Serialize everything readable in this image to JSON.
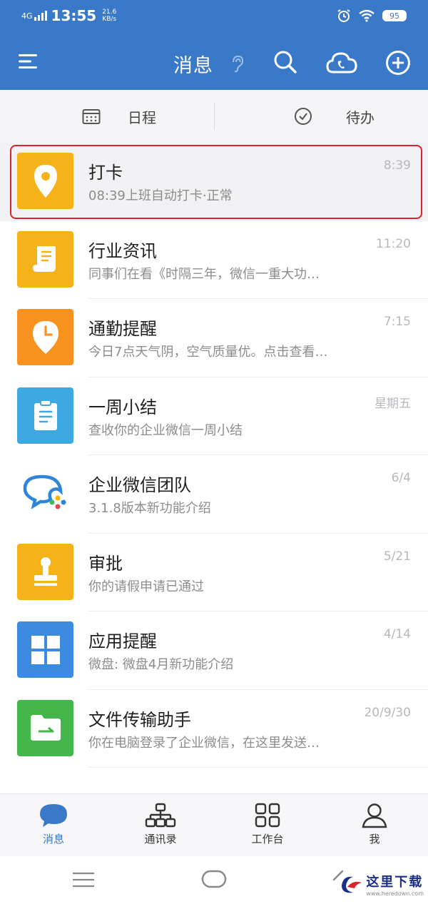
{
  "status_bar": {
    "network": "4G",
    "time": "13:55",
    "speed_value": "21.6",
    "speed_unit": "KB/s",
    "battery": "95"
  },
  "header": {
    "title": "消息"
  },
  "tabs": [
    {
      "label": "日程",
      "icon": "calendar-icon"
    },
    {
      "label": "待办",
      "icon": "check-circle-icon"
    }
  ],
  "messages": [
    {
      "name": "打卡",
      "preview": "08:39上班自动打卡·正常",
      "time": "8:39",
      "icon": "location-pin-icon",
      "color": "#f5b219"
    },
    {
      "name": "行业资讯",
      "preview": "同事们在看《时隔三年，微信一重大功…",
      "time": "11:20",
      "icon": "document-scroll-icon",
      "color": "#f5b219"
    },
    {
      "name": "通勤提醒",
      "preview": "今日7点天气阴，空气质量优。点击查看…",
      "time": "7:15",
      "icon": "clock-pin-icon",
      "color": "#f7931e"
    },
    {
      "name": "一周小结",
      "preview": "查收你的企业微信一周小结",
      "time": "星期五",
      "icon": "clipboard-icon",
      "color": "#3fa8e3"
    },
    {
      "name": "企业微信团队",
      "preview": "3.1.8版本新功能介绍",
      "time": "6/4",
      "icon": "wecom-logo-icon",
      "color": "#ffffff"
    },
    {
      "name": "审批",
      "preview": "你的请假申请已通过",
      "time": "5/21",
      "icon": "stamp-icon",
      "color": "#f5b219"
    },
    {
      "name": "应用提醒",
      "preview": "微盘: 微盘4月新功能介绍",
      "time": "4/14",
      "icon": "app-grid-icon",
      "color": "#3d8be0"
    },
    {
      "name": "文件传输助手",
      "preview": "你在电脑登录了企业微信，在这里发送…",
      "time": "20/9/30",
      "icon": "folder-transfer-icon",
      "color": "#45b649"
    }
  ],
  "bottom_tabs": [
    {
      "label": "消息",
      "icon": "chat-bubble-icon",
      "active": true
    },
    {
      "label": "通讯录",
      "icon": "org-chart-icon",
      "active": false
    },
    {
      "label": "工作台",
      "icon": "workbench-grid-icon",
      "active": false
    },
    {
      "label": "我",
      "icon": "person-icon",
      "active": false
    }
  ],
  "watermark": {
    "text": "这里下载",
    "url": "www.heredown.com"
  },
  "colors": {
    "brand_blue": "#3a78c8",
    "highlight_border": "#d9232e"
  }
}
